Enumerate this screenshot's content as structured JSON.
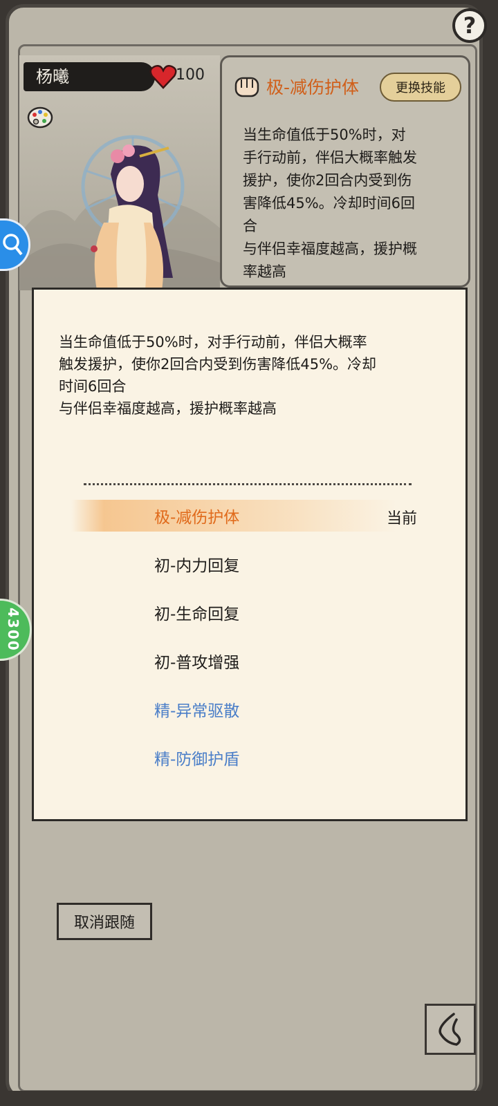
{
  "companion": {
    "name": "杨曦",
    "hp": "100"
  },
  "help_button": {
    "label": "?"
  },
  "side_badge": {
    "value": "4300"
  },
  "skill_card": {
    "title": "极-减伤护体",
    "change_button": "更换技能",
    "description": "当生命值低于50%时，对\n手行动前，伴侣大概率触发\n援护，使你2回合内受到伤\n害降低45%。冷却时间6回\n合\n与伴侣幸福度越高，援护概\n率越高"
  },
  "modal": {
    "description": "当生命值低于50%时，对手行动前，伴侣大概率\n触发援护，使你2回合内受到伤害降低45%。冷却\n时间6回合\n与伴侣幸福度越高，援护概率越高",
    "current_label": "当前",
    "skills": [
      {
        "label": "极-减伤护体",
        "color": "#e06a1b",
        "current": true
      },
      {
        "label": "初-内力回复",
        "color": "#1e1c1a",
        "current": false
      },
      {
        "label": "初-生命回复",
        "color": "#1e1c1a",
        "current": false
      },
      {
        "label": "初-普攻增强",
        "color": "#1e1c1a",
        "current": false
      },
      {
        "label": "精-异常驱散",
        "color": "#4a7ec8",
        "current": false
      },
      {
        "label": "精-防御护盾",
        "color": "#4a7ec8",
        "current": false
      }
    ]
  },
  "unfollow_button": "取消跟随",
  "icons": {
    "help": "question-icon",
    "heart": "heart-icon",
    "palette": "palette-icon",
    "fist": "fist-icon",
    "search": "search-icon",
    "back": "back-arrow-icon"
  }
}
